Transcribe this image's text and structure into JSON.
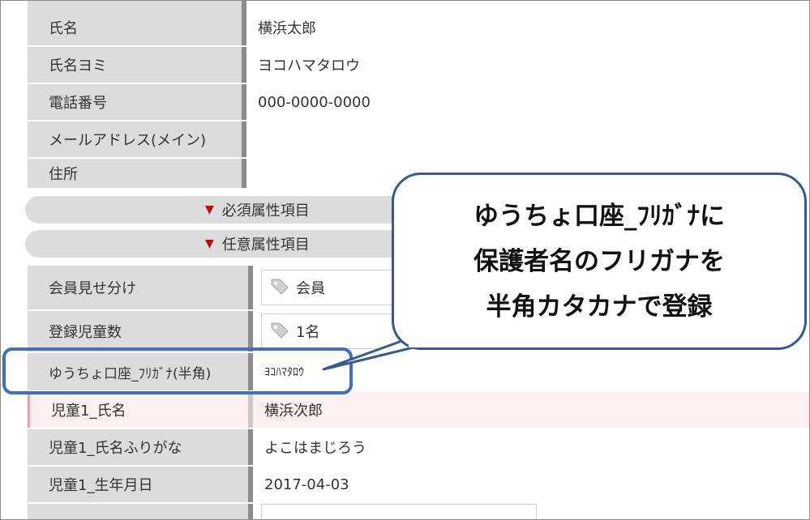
{
  "fields": [
    {
      "label": "氏名",
      "value": "横浜太郎"
    },
    {
      "label": "氏名ヨミ",
      "value": "ヨコハマタロウ"
    },
    {
      "label": "電話番号",
      "value": "000-0000-0000"
    },
    {
      "label": "メールアドレス(メイン)",
      "value": ""
    },
    {
      "label": "住所",
      "value": ""
    }
  ],
  "sections": {
    "required": "必須属性項目",
    "optional": "任意属性項目"
  },
  "optional_fields": {
    "member_view": {
      "label": "会員見せ分け",
      "value": "会員"
    },
    "child_count": {
      "label": "登録児童数",
      "value": "1名"
    },
    "bank_kana": {
      "label": "ゆうちょ口座_ﾌﾘｶﾞﾅ(半角)",
      "value": "ﾖｺﾊﾏﾀﾛｳ"
    },
    "child1_name": {
      "label": "児童1_氏名",
      "value": "横浜次郎"
    },
    "child1_furigana": {
      "label": "児童1_氏名ふりがな",
      "value": "よこはまじろう"
    },
    "child1_birthday": {
      "label": "児童1_生年月日",
      "value": "2017-04-03"
    }
  },
  "callout": {
    "line1": "ゆうちょ口座_ﾌﾘｶﾞﾅに",
    "line2": "保護者名のフリガナを",
    "line3": "半角カタカナで登録"
  },
  "colors": {
    "label_bg": "#dcdcdc",
    "label_border": "#8c8c8c",
    "highlight_border": "#3f6fbf",
    "highlight_row_bg": "#fdeef0",
    "accent_triangle": "#aa1111"
  },
  "icons": {
    "section_toggle": "triangle-down-icon",
    "tag": "tag-icon"
  }
}
